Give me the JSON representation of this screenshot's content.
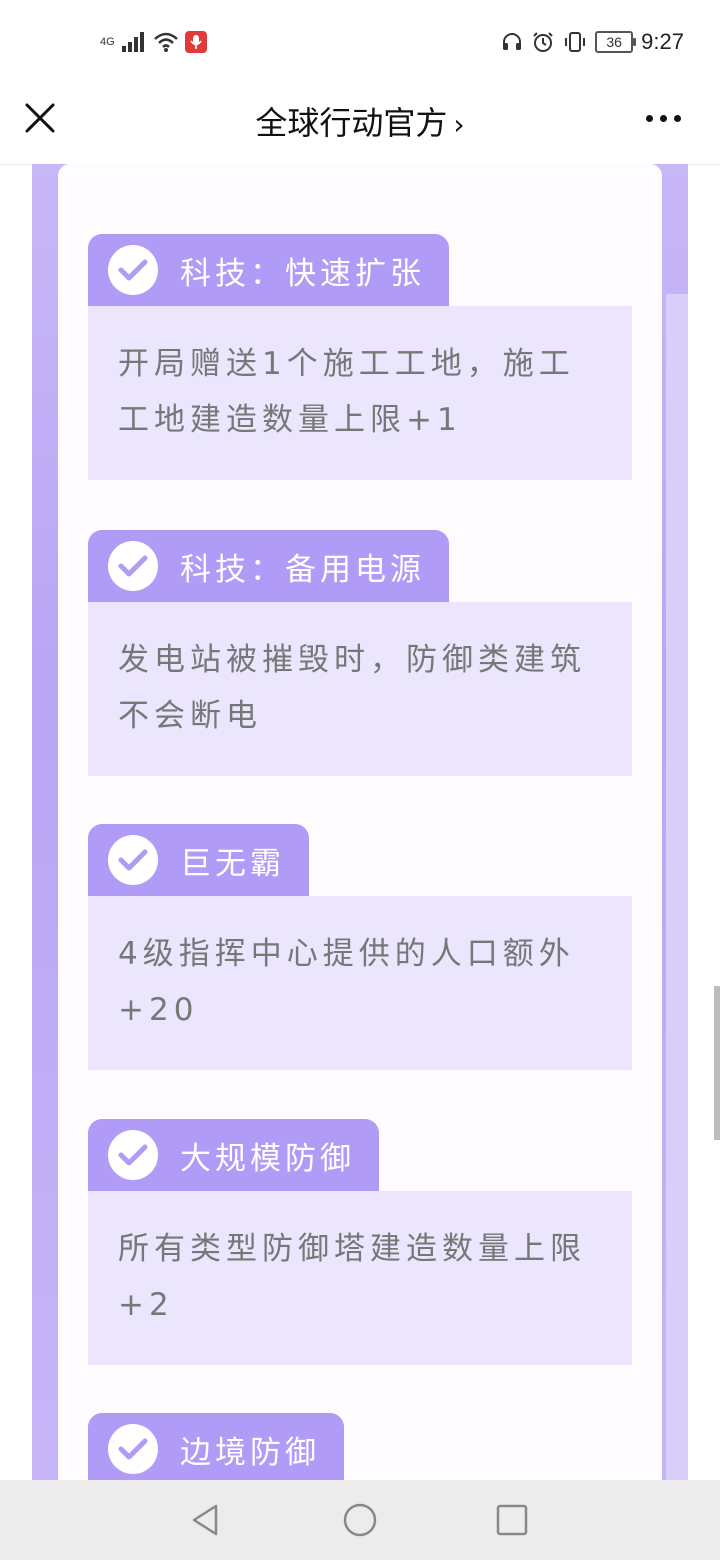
{
  "status_bar": {
    "network": "4G",
    "time": "9:27",
    "battery": "36"
  },
  "nav": {
    "title": "全球行动官方",
    "chevron": "›",
    "close_icon": "close-icon",
    "more_icon": "more-icon"
  },
  "items": [
    {
      "title": "科技：快速扩张",
      "body": "开局赠送1个施工工地，施工工地建造数量上限+1"
    },
    {
      "title": "科技：备用电源",
      "body": "发电站被摧毁时，防御类建筑不会断电"
    },
    {
      "title": "巨无霸",
      "body": "4级指挥中心提供的人口额外+20"
    },
    {
      "title": "大规模防御",
      "body": "所有类型防御塔建造数量上限+2"
    },
    {
      "title": "边境防御",
      "body": ""
    }
  ],
  "colors": {
    "accent": "#b09bf6",
    "body_bg": "#ebe6fd",
    "frame": "#c7b7f7"
  },
  "system_nav": {
    "back_icon": "back-triangle-icon",
    "home_icon": "home-circle-icon",
    "recents_icon": "recents-square-icon"
  }
}
